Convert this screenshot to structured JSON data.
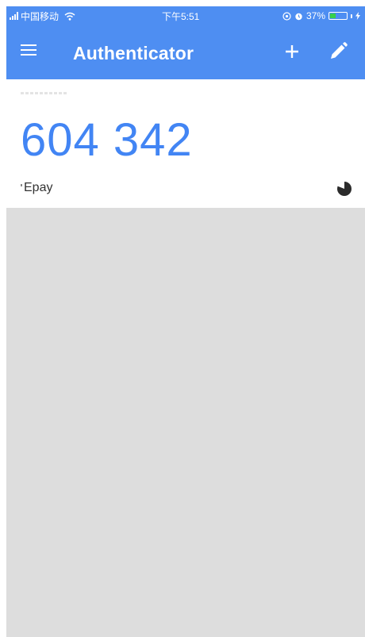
{
  "status_bar": {
    "carrier": "中国移动",
    "time": "下午5:51",
    "battery_percent": "37%",
    "battery_level": 0.37,
    "icons": [
      "signal-icon",
      "wifi-icon",
      "location-icon",
      "alarm-icon",
      "battery-icon",
      "charging-icon"
    ]
  },
  "app_bar": {
    "title": "Authenticator",
    "icons": [
      "menu-icon",
      "plus-icon",
      "pencil-icon"
    ]
  },
  "accounts": [
    {
      "code": "604 342",
      "name": "Epay",
      "timer_icon": "countdown-timer-icon"
    }
  ],
  "colors": {
    "app_bar": "#4e8ef2",
    "code_text": "#4285f4",
    "empty_area": "#dddddd",
    "battery_fill": "#37d04a"
  }
}
